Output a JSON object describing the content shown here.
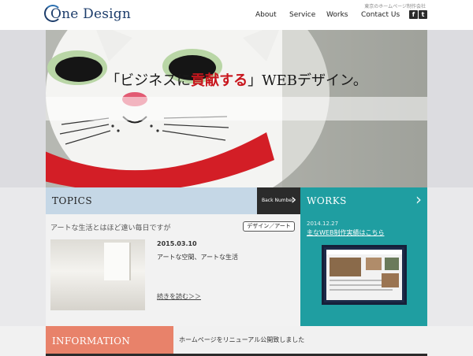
{
  "header": {
    "logo_text": "One Design",
    "tagline": "東京のホームページ制作会社",
    "nav": [
      {
        "label": "About"
      },
      {
        "label": "Service"
      },
      {
        "label": "Works"
      },
      {
        "label": "Contact Us"
      }
    ],
    "social": [
      {
        "icon": "facebook-icon",
        "glyph": "f"
      },
      {
        "icon": "twitter-icon",
        "glyph": "t"
      }
    ]
  },
  "hero": {
    "title_open": "「ビジネスに",
    "title_accent": "貢献する",
    "title_close": "」WEBデザイン。"
  },
  "topics": {
    "title": "TOPICS",
    "back_button": "Back Number",
    "post_heading": "アートな生活とはほど遠い毎日ですが",
    "category": "デザイン／アート",
    "date": "2015.03.10",
    "subtitle": "アートな空間、アートな生活",
    "read_more": "続きを読む＞＞"
  },
  "works": {
    "title": "WORKS",
    "date": "2014.12.27",
    "link": "主なWEB制作実績はこちら"
  },
  "information": {
    "title": "INFORMATION",
    "text": "ホームページをリニューアル公開致しました"
  },
  "colors": {
    "brand_navy": "#1d3d6b",
    "topics_blue": "#c5d7e6",
    "works_teal": "#1f9ea1",
    "info_salmon": "#e8826a",
    "accent_red": "#c8161d"
  }
}
